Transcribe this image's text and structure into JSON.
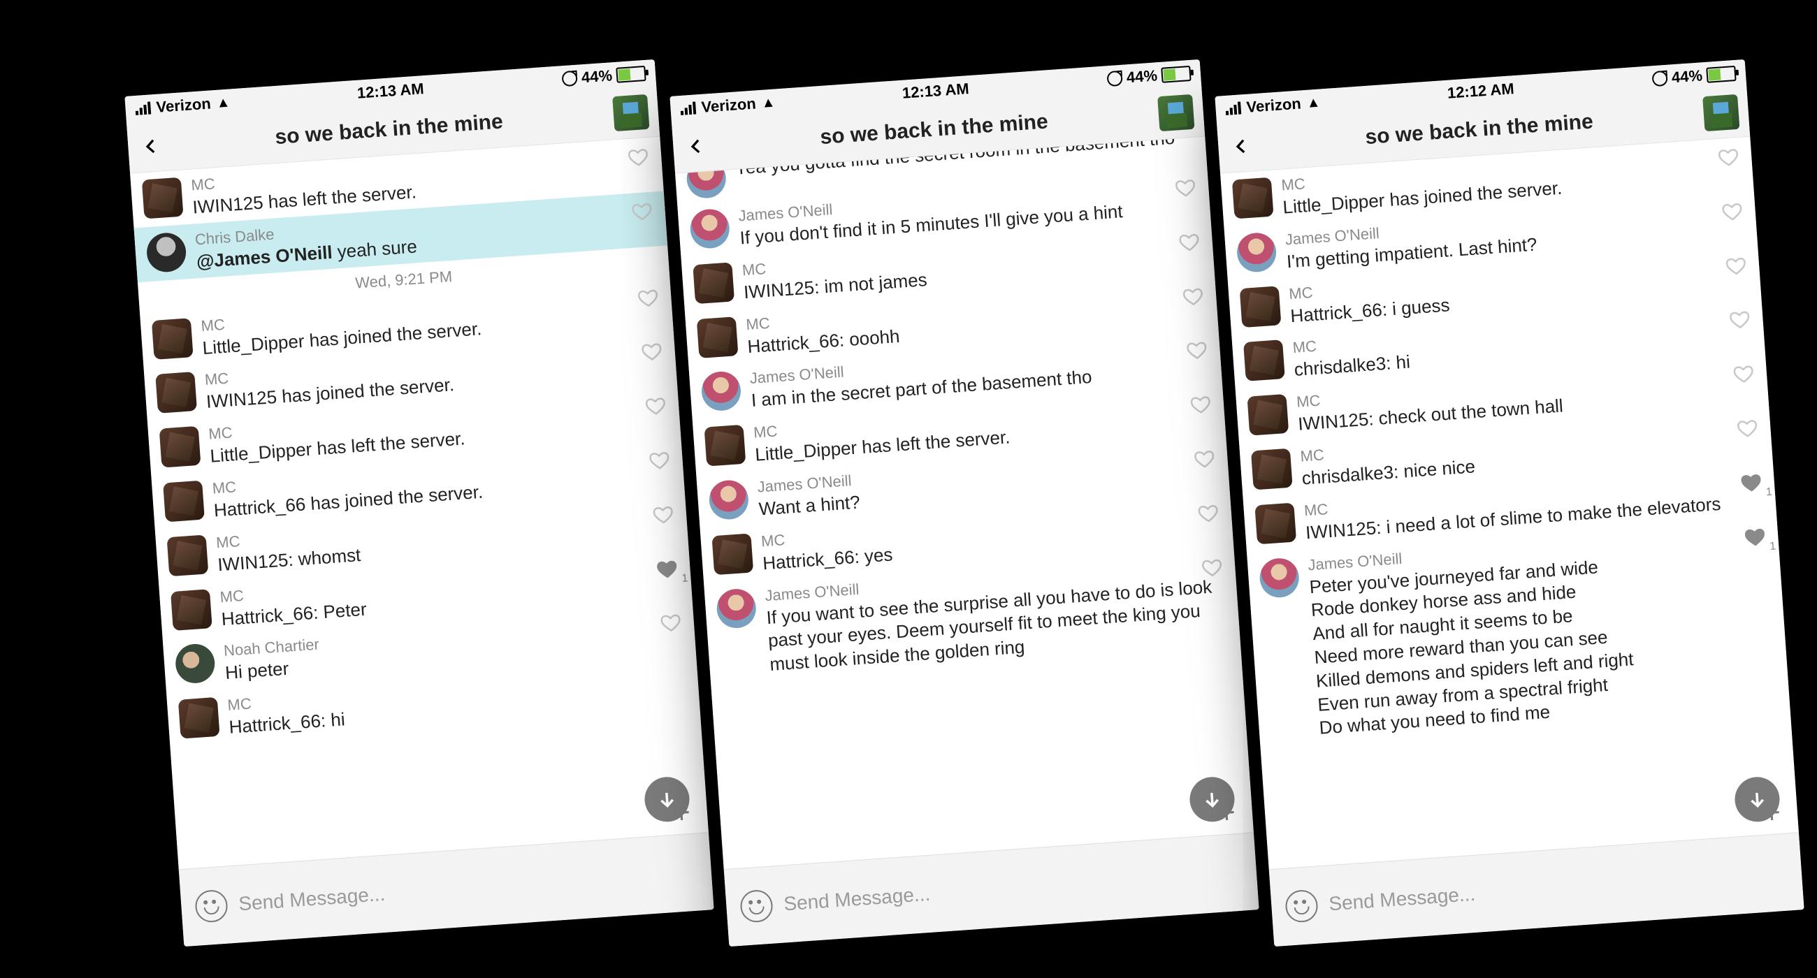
{
  "status": {
    "carrier": "Verizon",
    "battery_pct": "44%"
  },
  "chat_title": "so we back in the mine",
  "composer_placeholder": "Send Message...",
  "screens": [
    {
      "time": "12:13 AM",
      "messages": [
        {
          "avatar": "mc",
          "sender": "MC",
          "text": "IWIN125 has left the server.",
          "like": "empty"
        },
        {
          "avatar": "p-cd",
          "sender": "Chris Dalke",
          "mention": "@James O'Neill",
          "text_after": " yeah sure",
          "like": "empty",
          "highlight": true
        },
        {
          "date_sep": "Wed, 9:21 PM"
        },
        {
          "avatar": "mc",
          "sender": "MC",
          "text": "Little_Dipper has joined the server.",
          "like": "empty"
        },
        {
          "avatar": "mc",
          "sender": "MC",
          "text": "IWIN125 has joined the server.",
          "like": "empty"
        },
        {
          "avatar": "mc",
          "sender": "MC",
          "text": "Little_Dipper has left the server.",
          "like": "empty"
        },
        {
          "avatar": "mc",
          "sender": "MC",
          "text": "Hattrick_66 has joined the server.",
          "like": "empty"
        },
        {
          "avatar": "mc",
          "sender": "MC",
          "text": "IWIN125: whomst",
          "like": "empty"
        },
        {
          "avatar": "mc",
          "sender": "MC",
          "text": "Hattrick_66: Peter",
          "like": "filled",
          "like_count": "1"
        },
        {
          "avatar": "p-nc",
          "sender": "Noah Chartier",
          "text": "Hi peter",
          "like": "empty"
        },
        {
          "avatar": "mc",
          "sender": "MC",
          "text": "Hattrick_66: hi"
        }
      ]
    },
    {
      "time": "12:13 AM",
      "messages": [
        {
          "avatar": "p-jo",
          "text": "Yea you gotta find the secret room in the basement tho",
          "partial_top": true
        },
        {
          "avatar": "p-jo",
          "sender": "James O'Neill",
          "text": "If you don't find it in 5 minutes I'll give you a hint",
          "like": "empty"
        },
        {
          "avatar": "mc",
          "sender": "MC",
          "text": "IWIN125: im not james",
          "like": "empty"
        },
        {
          "avatar": "mc",
          "sender": "MC",
          "text": "Hattrick_66: ooohh",
          "like": "empty"
        },
        {
          "avatar": "p-jo",
          "sender": "James O'Neill",
          "text": "I am in the secret part of the basement tho",
          "like": "empty"
        },
        {
          "avatar": "mc",
          "sender": "MC",
          "text": "Little_Dipper has left the server.",
          "like": "empty"
        },
        {
          "avatar": "p-jo",
          "sender": "James O'Neill",
          "text": "Want a hint?",
          "like": "empty"
        },
        {
          "avatar": "mc",
          "sender": "MC",
          "text": "Hattrick_66: yes",
          "like": "empty"
        },
        {
          "avatar": "p-jo",
          "sender": "James O'Neill",
          "text": "If you want to see the surprise all you have to do is look past your eyes. Deem yourself fit to meet the king you must look inside the golden ring",
          "like": "empty"
        }
      ]
    },
    {
      "time": "12:12 AM",
      "messages": [
        {
          "avatar": "mc",
          "sender": "MC",
          "text": "Little_Dipper has joined the server.",
          "like": "empty"
        },
        {
          "avatar": "p-jo",
          "sender": "James O'Neill",
          "text": "I'm getting impatient. Last hint?",
          "like": "empty"
        },
        {
          "avatar": "mc",
          "sender": "MC",
          "text": "Hattrick_66: i guess",
          "like": "empty"
        },
        {
          "avatar": "mc",
          "sender": "MC",
          "text": "chrisdalke3: hi",
          "like": "empty"
        },
        {
          "avatar": "mc",
          "sender": "MC",
          "text": "IWIN125: check out the town hall",
          "like": "empty"
        },
        {
          "avatar": "mc",
          "sender": "MC",
          "text": "chrisdalke3: nice nice",
          "like": "empty"
        },
        {
          "avatar": "mc",
          "sender": "MC",
          "text": "IWIN125: i need a lot of slime to make the elevators",
          "like": "filled",
          "like_count": "1"
        },
        {
          "avatar": "p-jo",
          "sender": "James O'Neill",
          "text": "Peter you've journeyed far and wide\nRode donkey horse ass and hide\nAnd all for naught it seems to be\nNeed more reward than you can see\nKilled demons and spiders left and right\nEven run away from a spectral fright\nDo what you need to find me",
          "like": "filled",
          "like_count": "1"
        }
      ]
    }
  ]
}
